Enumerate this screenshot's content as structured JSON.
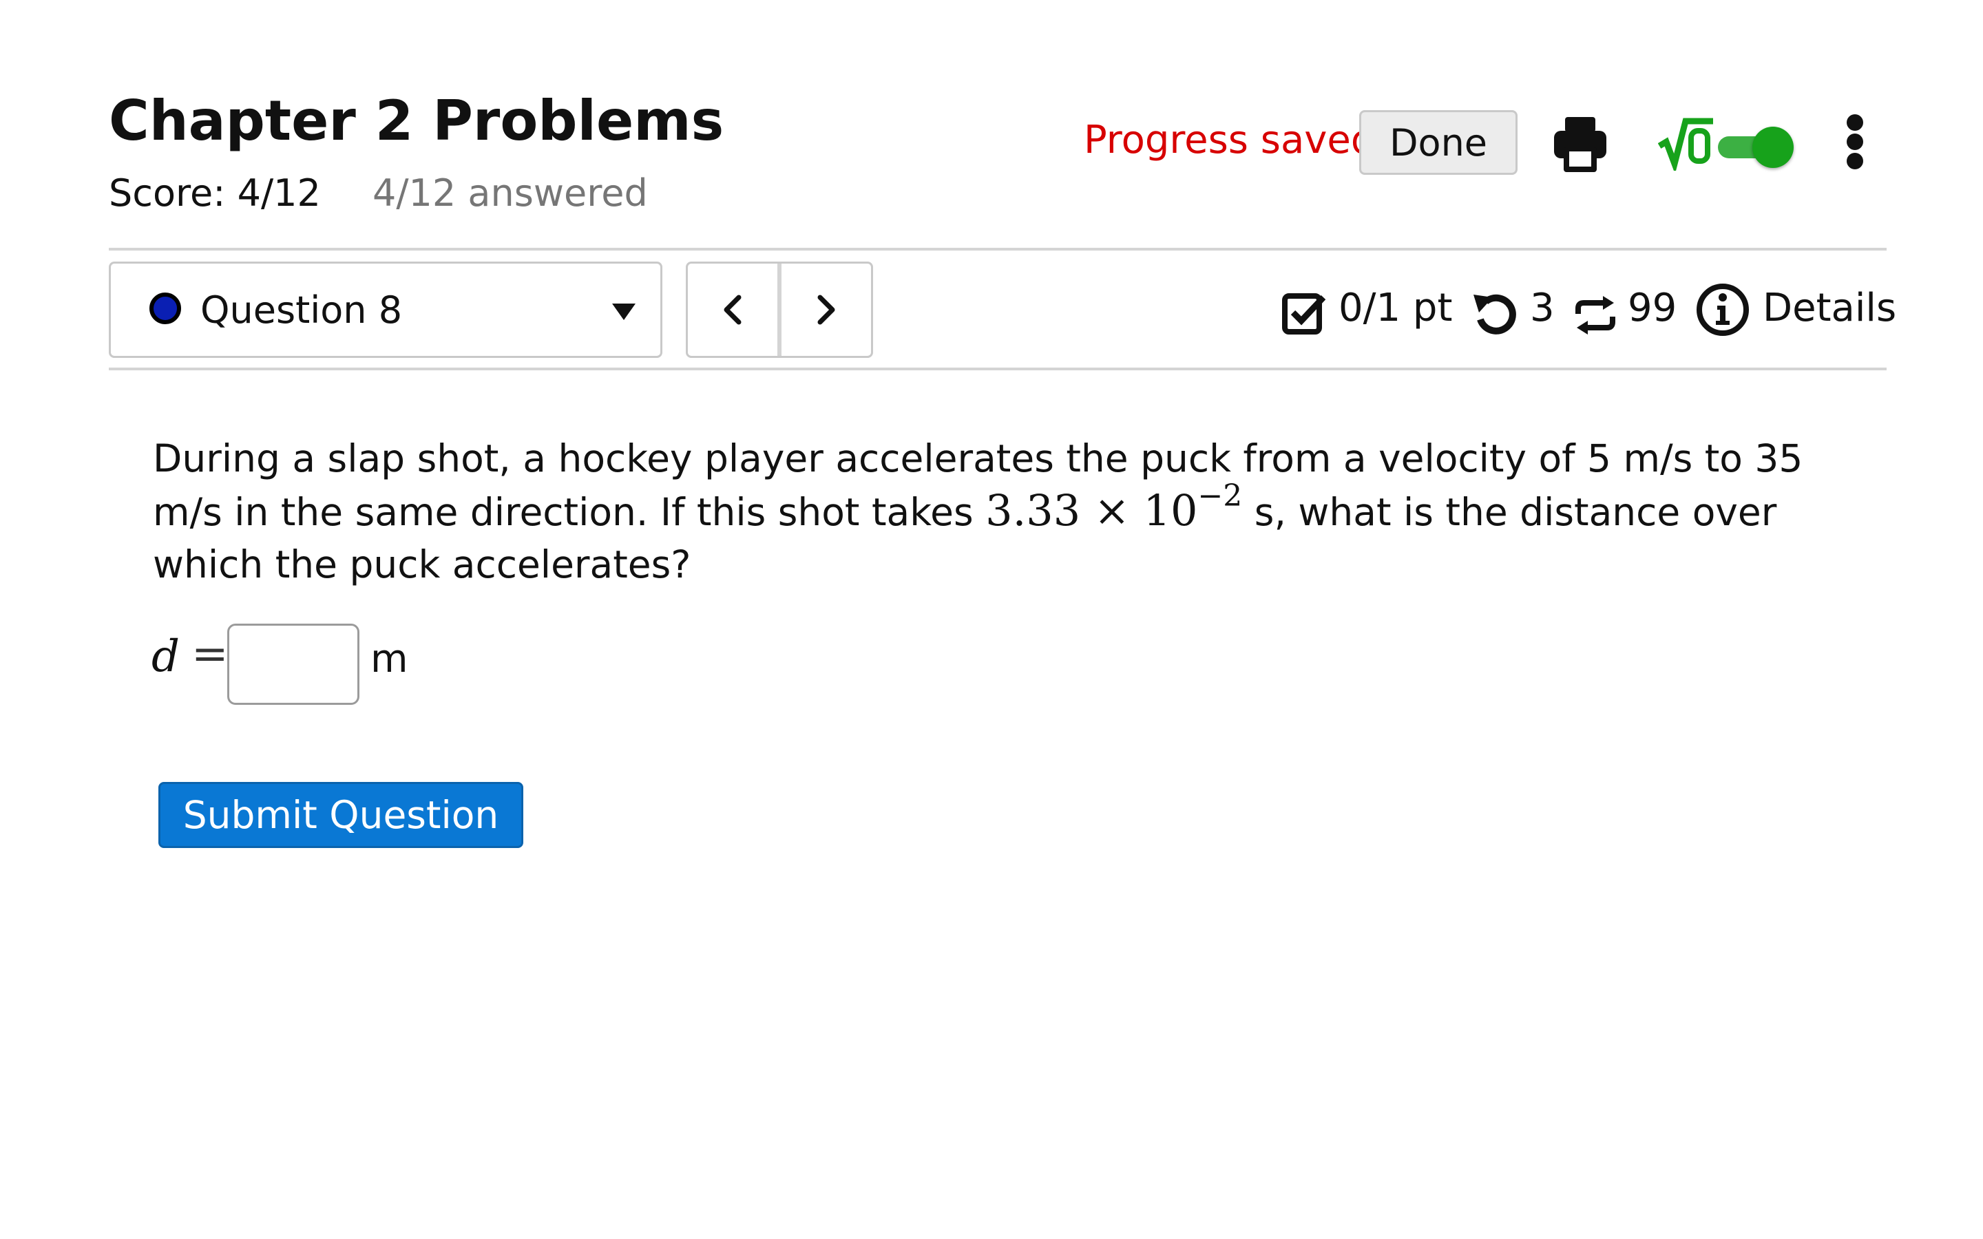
{
  "header": {
    "title": "Chapter 2 Problems",
    "score": "Score: 4/12",
    "answered": "4/12 answered",
    "progress_status": "Progress saved",
    "done_label": "Done",
    "math_toggle_on": true
  },
  "question_nav": {
    "selected_question": "Question 8"
  },
  "question_meta": {
    "points": "0/1 pt",
    "attempts_remaining": "3",
    "versions_remaining": "99",
    "details_label": "Details"
  },
  "question": {
    "text_part1": "During a slap shot, a hockey player accelerates the puck from a velocity of 5 m/s to 35 m/s in the same direction. If this shot takes ",
    "math_coefficient": "3.33 × 10",
    "math_exponent": "−2",
    "text_part2": " s, what is the distance over which the puck accelerates?",
    "answer_variable": "d",
    "answer_equals": "=",
    "answer_value": "",
    "answer_unit": "m",
    "submit_label": "Submit Question"
  },
  "colors": {
    "accent_blue": "#0a78d4",
    "progress_red": "#d70000",
    "toggle_green": "#17a21b",
    "question_dot": "#0a1fb3"
  }
}
